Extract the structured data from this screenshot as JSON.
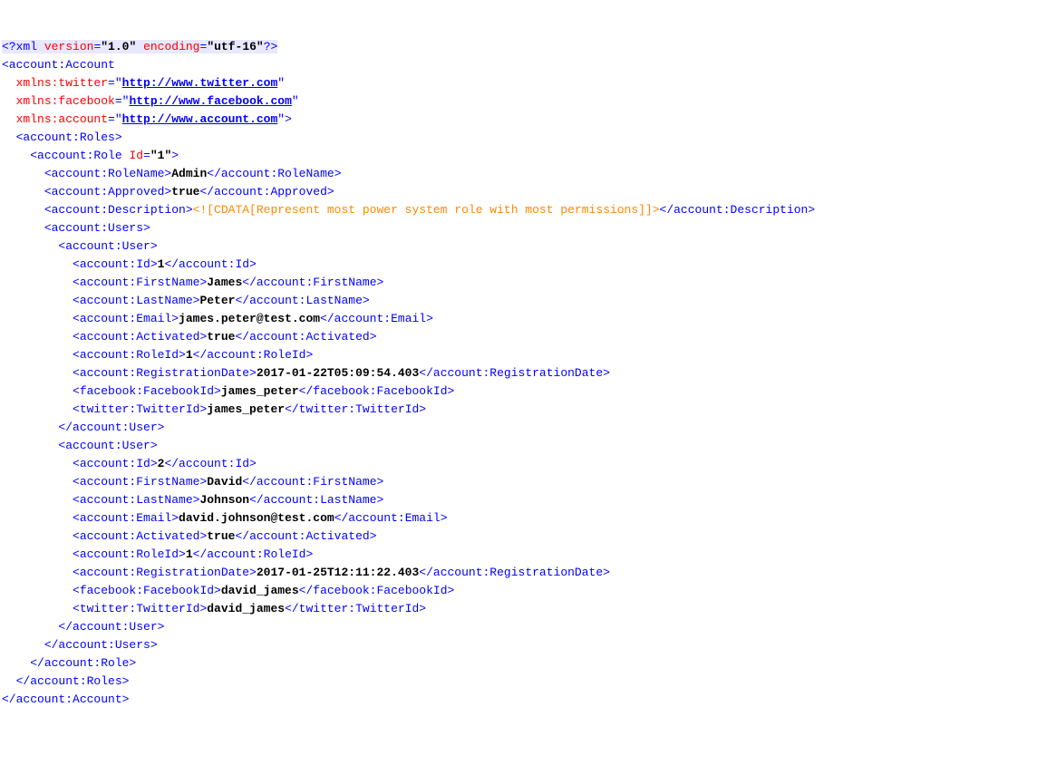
{
  "xml_decl": {
    "version_attr": "version",
    "version_val": "\"1.0\"",
    "encoding_attr": "encoding",
    "encoding_val": "\"utf-16\""
  },
  "root": {
    "open": "<account:Account",
    "close": "</account:Account>",
    "ns": {
      "twitter_attr": "xmlns:twitter",
      "twitter_url": "http://www.twitter.com",
      "facebook_attr": "xmlns:facebook",
      "facebook_url": "http://www.facebook.com",
      "account_attr": "xmlns:account",
      "account_url": "http://www.account.com"
    }
  },
  "roles": {
    "open": "<account:Roles>",
    "close": "</account:Roles>"
  },
  "role": {
    "open": "<account:Role",
    "id_attr": "Id",
    "id_val": "\"1\"",
    "close": "</account:Role>",
    "roleName": {
      "open": "<account:RoleName>",
      "val": "Admin",
      "close": "</account:RoleName>"
    },
    "approved": {
      "open": "<account:Approved>",
      "val": "true",
      "close": "</account:Approved>"
    },
    "description": {
      "open": "<account:Description>",
      "cdata": "<![CDATA[Represent most power system role with most permissions]]>",
      "close": "</account:Description>"
    }
  },
  "users": {
    "open": "<account:Users>",
    "close": "</account:Users>"
  },
  "user1": {
    "open": "<account:User>",
    "close": "</account:User>",
    "id": {
      "open": "<account:Id>",
      "val": "1",
      "close": "</account:Id>"
    },
    "firstName": {
      "open": "<account:FirstName>",
      "val": "James",
      "close": "</account:FirstName>"
    },
    "lastName": {
      "open": "<account:LastName>",
      "val": "Peter",
      "close": "</account:LastName>"
    },
    "email": {
      "open": "<account:Email>",
      "val": "james.peter@test.com",
      "close": "</account:Email>"
    },
    "activated": {
      "open": "<account:Activated>",
      "val": "true",
      "close": "</account:Activated>"
    },
    "roleId": {
      "open": "<account:RoleId>",
      "val": "1",
      "close": "</account:RoleId>"
    },
    "regDate": {
      "open": "<account:RegistrationDate>",
      "val": "2017-01-22T05:09:54.403",
      "close": "</account:RegistrationDate>"
    },
    "fb": {
      "open": "<facebook:FacebookId>",
      "val": "james_peter",
      "close": "</facebook:FacebookId>"
    },
    "tw": {
      "open": "<twitter:TwitterId>",
      "val": "james_peter",
      "close": "</twitter:TwitterId>"
    }
  },
  "user2": {
    "open": "<account:User>",
    "close": "</account:User>",
    "id": {
      "open": "<account:Id>",
      "val": "2",
      "close": "</account:Id>"
    },
    "firstName": {
      "open": "<account:FirstName>",
      "val": "David",
      "close": "</account:FirstName>"
    },
    "lastName": {
      "open": "<account:LastName>",
      "val": "Johnson",
      "close": "</account:LastName>"
    },
    "email": {
      "open": "<account:Email>",
      "val": "david.johnson@test.com",
      "close": "</account:Email>"
    },
    "activated": {
      "open": "<account:Activated>",
      "val": "true",
      "close": "</account:Activated>"
    },
    "roleId": {
      "open": "<account:RoleId>",
      "val": "1",
      "close": "</account:RoleId>"
    },
    "regDate": {
      "open": "<account:RegistrationDate>",
      "val": "2017-01-25T12:11:22.403",
      "close": "</account:RegistrationDate>"
    },
    "fb": {
      "open": "<facebook:FacebookId>",
      "val": "david_james",
      "close": "</facebook:FacebookId>"
    },
    "tw": {
      "open": "<twitter:TwitterId>",
      "val": "david_james",
      "close": "</twitter:TwitterId>"
    }
  },
  "punct": {
    "lt_q": "<?",
    "xml": "xml",
    "q_gt": "?>",
    "eq": "=",
    "dq": "\"",
    "gt": ">",
    "close_gt": "\">"
  }
}
